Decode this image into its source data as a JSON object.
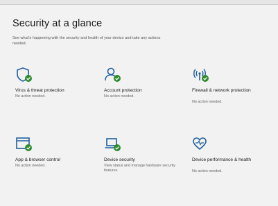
{
  "page": {
    "title": "Security at a glance",
    "description": "See what's happening with the security and health of your device and take any actions needed."
  },
  "tiles": [
    {
      "title": "Virus & threat protection",
      "status": "No action needed.",
      "icon": "shield-icon"
    },
    {
      "title": "Account protection",
      "status": "No action needed.",
      "icon": "person-icon"
    },
    {
      "title": "Firewall & network protection",
      "status": "No action needed.",
      "icon": "wifi-antenna-icon"
    },
    {
      "title": "App & browser control",
      "status": "No action needed.",
      "icon": "browser-window-icon"
    },
    {
      "title": "Device security",
      "status": "View status and manage hardware security features",
      "icon": "laptop-icon"
    },
    {
      "title": "Device performance & health",
      "status": "No action needed.",
      "icon": "heart-icon"
    }
  ],
  "colors": {
    "accent": "#1f5f9e",
    "check_badge": "#2e8b2e",
    "background": "#f2f2f2"
  }
}
